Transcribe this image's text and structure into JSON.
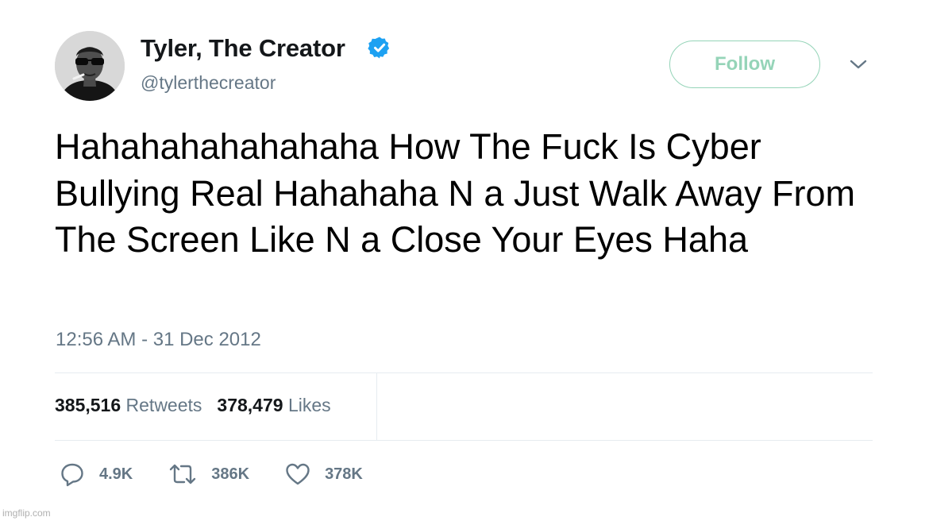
{
  "author": {
    "display_name": "Tyler, The Creator",
    "handle": "@tylerthecreator",
    "verified": true,
    "avatar_icon": "profile-photo"
  },
  "follow_button": {
    "label": "Follow",
    "color": "#95d4b8"
  },
  "menu_icon": "chevron-down-icon",
  "tweet": {
    "text": "Hahahahahahahaha How The Fuck Is Cyber Bullying Real Hahahaha N      a Just Walk Away From The Screen Like N      a Close Your Eyes Haha",
    "timestamp": "12:56 AM - 31 Dec 2012"
  },
  "stats": {
    "retweets_count": "385,516",
    "retweets_label": "Retweets",
    "likes_count": "378,479",
    "likes_label": "Likes"
  },
  "actions": {
    "replies": "4.9K",
    "retweets": "386K",
    "likes": "378K"
  },
  "watermark": "imgflip.com",
  "colors": {
    "verified_blue": "#1da1f2",
    "secondary_text": "#657786",
    "divider": "#e6ecf0"
  }
}
